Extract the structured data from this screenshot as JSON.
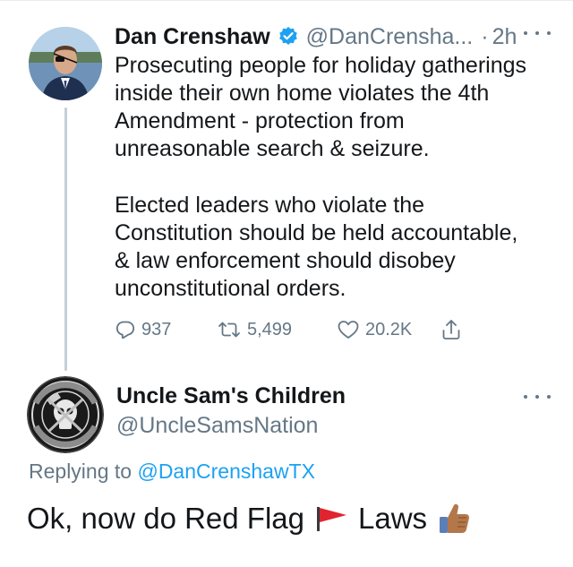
{
  "tweet1": {
    "name": "Dan Crenshaw",
    "handle": "@DanCrensha...",
    "separator": "·",
    "time": "2h",
    "paragraph1": "Prosecuting people for holiday gatherings\ninside their own home violates the 4th\nAmendment - protection from\nunreasonable search & seizure.",
    "paragraph2": "Elected leaders who violate the\nConstitution should be held accountable,\n& law enforcement should disobey\nunconstitutional orders.",
    "replies": "937",
    "retweets": "5,499",
    "likes": "20.2K"
  },
  "tweet2": {
    "name": "Uncle Sam's Children",
    "handle": "@UncleSamsNation",
    "replying_prefix": "Replying to",
    "replying_to": "@DanCrenshawTX",
    "text_before": "Ok, now do Red Flag",
    "text_after": "Laws",
    "logo_text": "Uncle Sam's Children"
  },
  "colors": {
    "text": "#14171a",
    "secondary": "#657786",
    "link": "#1da1f2",
    "verified": "#1da1f2",
    "thread_line": "#c4cfd6"
  },
  "icons": {
    "verified": "verified-badge-icon",
    "reply": "reply-icon",
    "retweet": "retweet-icon",
    "like": "heart-icon",
    "share": "share-icon",
    "more": "more-icon",
    "flag": "triangular-flag-emoji",
    "thumb": "thumbs-up-emoji"
  }
}
